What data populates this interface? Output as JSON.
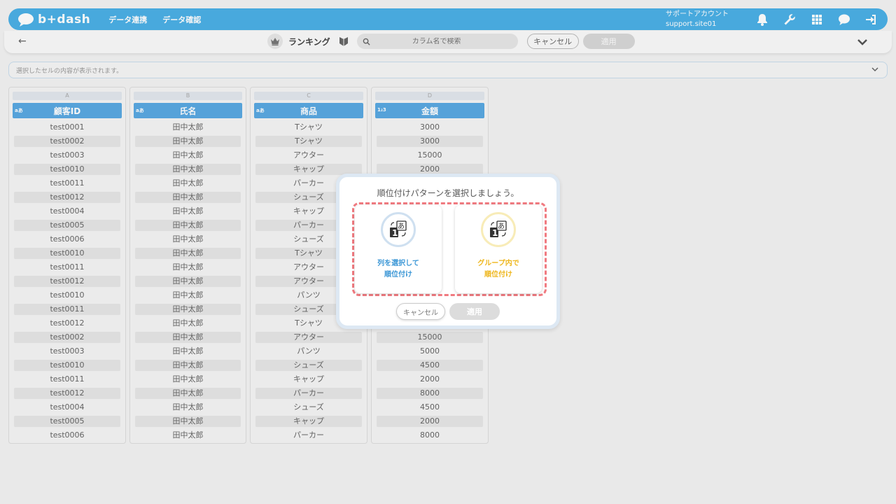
{
  "header": {
    "logo_text": "b+dash",
    "nav": [
      "データ連携",
      "データ確認"
    ],
    "account_line1": "サポートアカウント",
    "account_line2": "support.site01"
  },
  "toolbar": {
    "title": "ランキング",
    "search_placeholder": "カラム名で検索",
    "cancel_label": "キャンセル",
    "apply_label": "適用"
  },
  "cell_bar": {
    "text": "選択したセルの内容が表示されます。"
  },
  "columns": [
    {
      "letter": "A",
      "type": "aあ",
      "header": "顧客ID",
      "values": [
        "test0001",
        "test0002",
        "test0003",
        "test0010",
        "test0011",
        "test0012",
        "test0004",
        "test0005",
        "test0006",
        "test0010",
        "test0011",
        "test0012",
        "test0010",
        "test0011",
        "test0012",
        "test0002",
        "test0003",
        "test0010",
        "test0011",
        "test0012",
        "test0004",
        "test0005",
        "test0006"
      ]
    },
    {
      "letter": "B",
      "type": "aあ",
      "header": "氏名",
      "values": [
        "田中太郎",
        "田中太郎",
        "田中太郎",
        "田中太郎",
        "田中太郎",
        "田中太郎",
        "田中太郎",
        "田中太郎",
        "田中太郎",
        "田中太郎",
        "田中太郎",
        "田中太郎",
        "田中太郎",
        "田中太郎",
        "田中太郎",
        "田中太郎",
        "田中太郎",
        "田中太郎",
        "田中太郎",
        "田中太郎",
        "田中太郎",
        "田中太郎",
        "田中太郎"
      ]
    },
    {
      "letter": "C",
      "type": "aあ",
      "header": "商品",
      "values": [
        "Tシャツ",
        "Tシャツ",
        "アウター",
        "キャップ",
        "パーカー",
        "シューズ",
        "キャップ",
        "パーカー",
        "シューズ",
        "Tシャツ",
        "アウター",
        "アウター",
        "パンツ",
        "シューズ",
        "Tシャツ",
        "アウター",
        "パンツ",
        "シューズ",
        "キャップ",
        "パーカー",
        "シューズ",
        "キャップ",
        "パーカー"
      ]
    },
    {
      "letter": "D",
      "type": "1₂3",
      "header": "金額",
      "values": [
        "3000",
        "3000",
        "15000",
        "2000",
        "",
        "",
        "",
        "",
        "",
        "",
        "",
        "",
        "",
        "",
        "",
        "15000",
        "5000",
        "4500",
        "2000",
        "8000",
        "4500",
        "2000",
        "8000"
      ]
    }
  ],
  "modal": {
    "title": "順位付けパターンを選択しましょう。",
    "option1_line1": "列を選択して",
    "option1_line2": "順位付け",
    "option2_line1": "グループ内で",
    "option2_line2": "順位付け",
    "cancel_label": "キャンセル",
    "apply_label": "適用"
  },
  "colors": {
    "brand": "#4bb0e6",
    "column_header": "#5aa9e2",
    "highlight_dash": "#f07a80",
    "option_blue": "#3c97d6",
    "option_yellow": "#eeb61c"
  }
}
